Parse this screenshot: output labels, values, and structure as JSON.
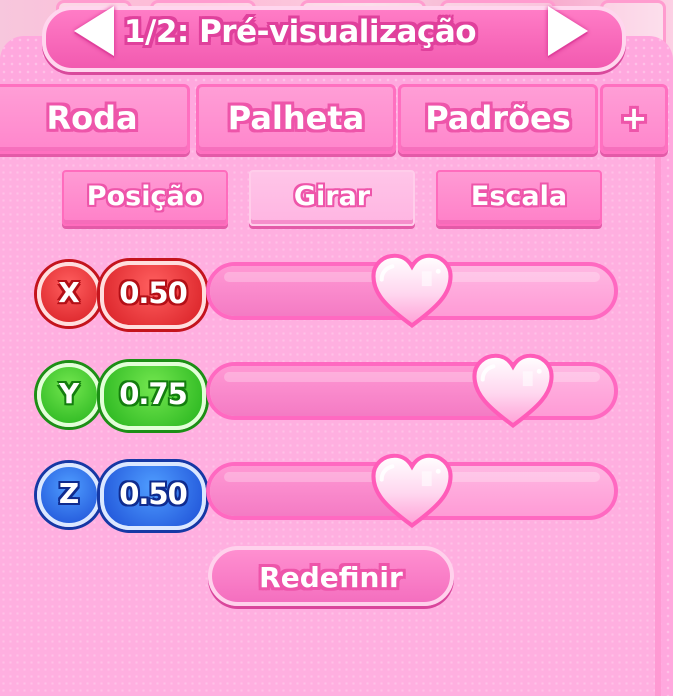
{
  "header": {
    "title": "1/2: Pré-visualização",
    "prev_icon": "left-arrow-icon",
    "next_icon": "right-arrow-icon"
  },
  "tabs": [
    {
      "label": "Roda"
    },
    {
      "label": "Palheta"
    },
    {
      "label": "Padrões"
    },
    {
      "label": "+"
    }
  ],
  "subtabs": [
    {
      "label": "Posição",
      "selected": false
    },
    {
      "label": "Girar",
      "selected": true
    },
    {
      "label": "Escala",
      "selected": false
    }
  ],
  "axes": [
    {
      "axis": "X",
      "value": "0.50",
      "level": 0.5,
      "color": "#e52a2f"
    },
    {
      "axis": "Y",
      "value": "0.75",
      "level": 0.75,
      "color": "#2dbb22"
    },
    {
      "axis": "Z",
      "value": "0.50",
      "level": 0.5,
      "color": "#2456dd"
    }
  ],
  "reset_label": "Redefinir",
  "colors": {
    "accent": "#f25ab0",
    "panel": "#ffa8de",
    "track": "#ff69c1"
  }
}
